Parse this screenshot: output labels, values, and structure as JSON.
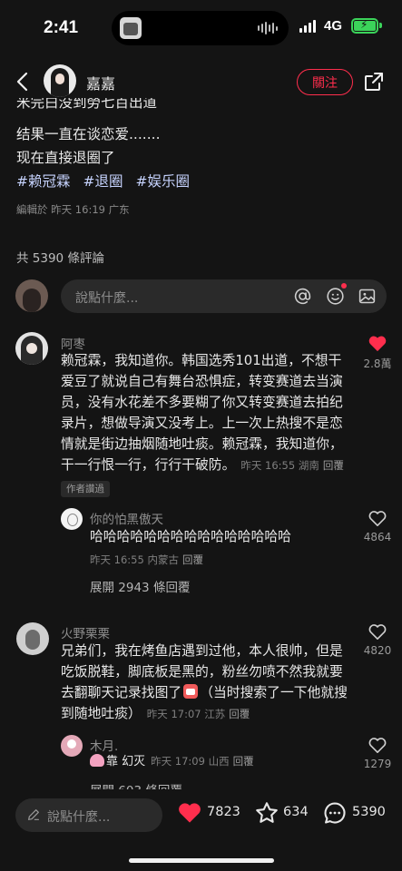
{
  "status_bar": {
    "time": "2:41",
    "network": "4G"
  },
  "nav": {
    "name": "嘉嘉",
    "follow_label": "關注"
  },
  "post": {
    "partial_line": "米完白没到勞七百出道",
    "lines": [
      "结果一直在谈恋爱.......",
      "现在直接退圈了"
    ],
    "hashtags": [
      "#赖冠霖",
      "#退圈",
      "#娱乐圈"
    ],
    "edited": "編輯於 昨天 16:19 广东"
  },
  "comments_count": "共 5390 條評論",
  "composer": {
    "placeholder": "說點什麼..."
  },
  "comments": [
    {
      "author": "阿枣",
      "body": "赖冠霖，我知道你。韩国选秀101出道，不想干爱豆了就说自己有舞台恐惧症，转变赛道去当演员，没有水花差不多要糊了你又转变赛道去拍纪录片，想做导演又没考上。上一次上热搜不是恋情就是街边抽烟随地吐痰。赖冠霖，我知道你，干一行恨一行，行行干破防。",
      "meta": "昨天 16:55 湖南",
      "reply_label": "回覆",
      "likes": "2.8萬",
      "tag": "作者讚過",
      "reply": {
        "author": "你的怕黑傲天",
        "body": "哈哈哈哈哈哈哈哈哈哈哈哈哈哈哈",
        "meta": "昨天 16:55 内蒙古",
        "reply_label": "回覆",
        "likes": "4864"
      },
      "expand": "展開 2943 條回覆"
    },
    {
      "author": "火野栗栗",
      "body_before": "兄弟们，我在烤鱼店遇到过他，本人很帅，但是吃饭脱鞋，脚底板是黑的，粉丝勿喷不然我就要去翻聊天记录找图了",
      "body_after": "（当时搜索了一下他就搜到随地吐痰）",
      "meta": "昨天 17:07 江苏",
      "reply_label": "回覆",
      "likes": "4820",
      "reply": {
        "author": "木月.",
        "body": "靠  幻灭",
        "meta": "昨天 17:09 山西",
        "reply_label": "回覆",
        "likes": "1279"
      },
      "expand": "展開 603 條回覆"
    }
  ],
  "bottom_bar": {
    "placeholder": "說點什麼...",
    "likes": "7823",
    "stars": "634",
    "comments": "5390"
  },
  "colors": {
    "accent": "#ff2e4d",
    "hashtag": "#c7d4ff",
    "battery": "#3bd35a"
  }
}
